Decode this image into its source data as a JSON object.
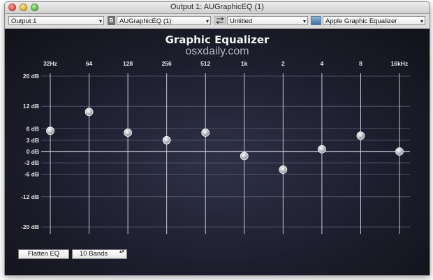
{
  "window": {
    "title": "Output 1: AUGraphicEQ (1)"
  },
  "toolbar": {
    "output_select": "Output 1",
    "au_badge": "B",
    "au_select": "AUGraphicEQ (1)",
    "preset_select": "Untitled",
    "equalizer_select": "Apple Graphic Equalizer",
    "dropdown_arrow": "▾"
  },
  "eq": {
    "title": "Graphic Equalizer",
    "watermark": "osxdaily.com",
    "bands": [
      {
        "label": "32Hz",
        "gain_db": 5.5
      },
      {
        "label": "64",
        "gain_db": 10.5
      },
      {
        "label": "128",
        "gain_db": 5
      },
      {
        "label": "256",
        "gain_db": 3
      },
      {
        "label": "512",
        "gain_db": 5
      },
      {
        "label": "1k",
        "gain_db": -1.2
      },
      {
        "label": "2",
        "gain_db": -4.8
      },
      {
        "label": "4",
        "gain_db": 0.6
      },
      {
        "label": "8",
        "gain_db": 4.2
      },
      {
        "label": "16kHz",
        "gain_db": 0
      }
    ],
    "db_ticks": [
      {
        "value": 20,
        "label": "20 dB"
      },
      {
        "value": 12,
        "label": "12 dB"
      },
      {
        "value": 6,
        "label": "6 dB"
      },
      {
        "value": 3,
        "label": "3 dB"
      },
      {
        "value": 0,
        "label": "0 dB"
      },
      {
        "value": -3,
        "label": "-3 dB"
      },
      {
        "value": -6,
        "label": "-6 dB"
      },
      {
        "value": -12,
        "label": "-12 dB"
      },
      {
        "value": -20,
        "label": "-20 dB"
      }
    ],
    "db_range": [
      -20,
      20
    ]
  },
  "controls": {
    "flatten_label": "Flatten EQ",
    "bands_select": "10 Bands",
    "stepper_glyph": "▴▾"
  }
}
